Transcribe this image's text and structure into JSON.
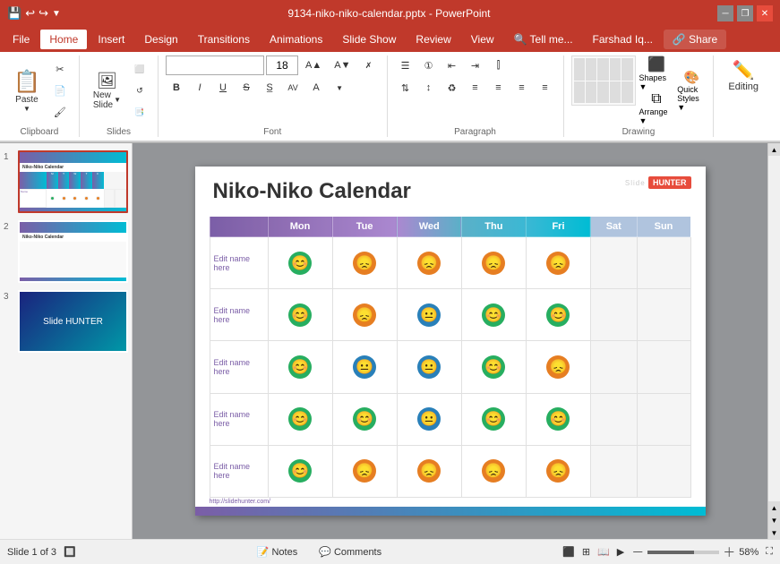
{
  "titleBar": {
    "title": "9134-niko-niko-calendar.pptx - PowerPoint",
    "controls": [
      "minimize",
      "restore",
      "close"
    ]
  },
  "menuBar": {
    "items": [
      "File",
      "Home",
      "Insert",
      "Design",
      "Transitions",
      "Animations",
      "Slide Show",
      "Review",
      "View",
      "Tell me...",
      "Farshad Iq...",
      "Share"
    ]
  },
  "ribbon": {
    "clipboard": {
      "label": "Clipboard"
    },
    "slides": {
      "label": "Slides"
    },
    "font": {
      "label": "Font",
      "fontName": "",
      "fontSize": "18",
      "bold": "B",
      "italic": "I",
      "underline": "U",
      "strikethrough": "S",
      "fontColor": "A"
    },
    "paragraph": {
      "label": "Paragraph"
    },
    "drawing": {
      "label": "Drawing",
      "shapes": "Shapes",
      "arrange": "Arrange",
      "quickStyles": "Quick Styles"
    },
    "editing": {
      "label": "Editing"
    }
  },
  "slides": [
    {
      "num": "1",
      "active": true
    },
    {
      "num": "2",
      "active": false
    },
    {
      "num": "3",
      "active": false
    }
  ],
  "slideContent": {
    "title": "Niko-Niko Calendar",
    "logoText": "Slide HUNTER",
    "columns": [
      "Mon",
      "Tue",
      "Wed",
      "Thu",
      "Fri",
      "Sat",
      "Sun"
    ],
    "rows": [
      {
        "name": "Edit name here",
        "faces": [
          "happy",
          "sad",
          "sad",
          "sad",
          "sad",
          "",
          ""
        ]
      },
      {
        "name": "Edit name here",
        "faces": [
          "happy",
          "sad",
          "neutral",
          "happy",
          "happy",
          "",
          ""
        ]
      },
      {
        "name": "Edit name here",
        "faces": [
          "happy",
          "neutral",
          "neutral",
          "happy",
          "sad",
          "",
          ""
        ]
      },
      {
        "name": "Edit name here",
        "faces": [
          "happy",
          "happy",
          "neutral",
          "happy",
          "happy",
          "",
          ""
        ]
      },
      {
        "name": "Edit name here",
        "faces": [
          "happy",
          "sad",
          "sad",
          "sad",
          "sad",
          "",
          ""
        ]
      }
    ],
    "url": "http://slidehunter.com/",
    "footerGradient": true
  },
  "statusBar": {
    "slideInfo": "Slide 1 of 3",
    "notes": "Notes",
    "comments": "Comments",
    "zoom": "58%"
  },
  "icons": {
    "save": "💾",
    "undo": "↩",
    "redo": "↪",
    "customQuickAccess": "⚡",
    "paste": "📋",
    "cut": "✂",
    "copy": "📄",
    "formatPainter": "🖌",
    "newSlide": "＋",
    "search": "🔍",
    "happy": "😊",
    "sad": "😞",
    "neutral": "😐"
  }
}
